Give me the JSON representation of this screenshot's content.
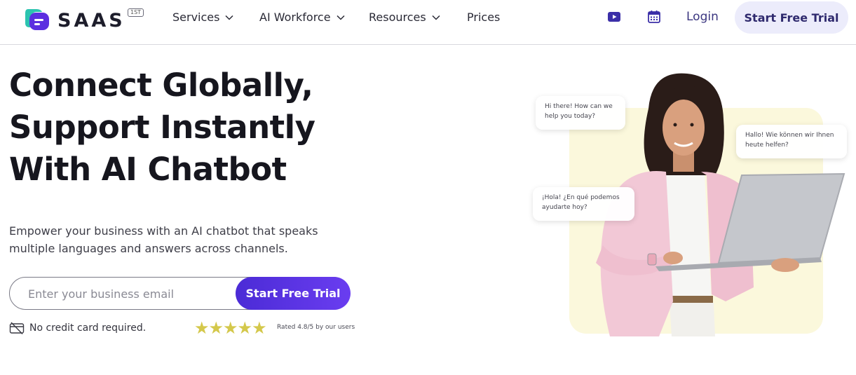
{
  "brand": {
    "name": "SAAS",
    "badge": "1ST",
    "colors": {
      "accent": "#5b33e6",
      "teal": "#2cc4b0",
      "yellow_panel": "#fbf8dc"
    }
  },
  "nav": {
    "items": [
      {
        "label": "Services",
        "has_dropdown": true
      },
      {
        "label": "AI Workforce",
        "has_dropdown": true
      },
      {
        "label": "Resources",
        "has_dropdown": true
      },
      {
        "label": "Prices",
        "has_dropdown": false
      }
    ],
    "icons": [
      "play-video-icon",
      "calendar-icon"
    ],
    "login_label": "Login",
    "cta_label": "Start Free Trial"
  },
  "hero": {
    "headline_lines": [
      "Connect Globally,",
      "Support Instantly",
      "With AI Chatbot"
    ],
    "subtext_lines": [
      "Empower your business with an AI chatbot that speaks",
      "multiple languages and answers across channels."
    ],
    "email_placeholder": "Enter your business email",
    "email_value": "",
    "cta_label": "Start Free Trial",
    "no_card_label": "No credit card required.",
    "rating": {
      "stars": 5,
      "text": "Rated 4.8/5 by our users"
    }
  },
  "chat_bubbles": [
    {
      "lines": [
        "Hi there! How can we",
        "help you today?"
      ]
    },
    {
      "lines": [
        "Hallo! Wie können wir Ihnen",
        "heute helfen?"
      ]
    },
    {
      "lines": [
        "¡Hola! ¿En qué podemos",
        "ayudarte hoy?"
      ]
    }
  ]
}
